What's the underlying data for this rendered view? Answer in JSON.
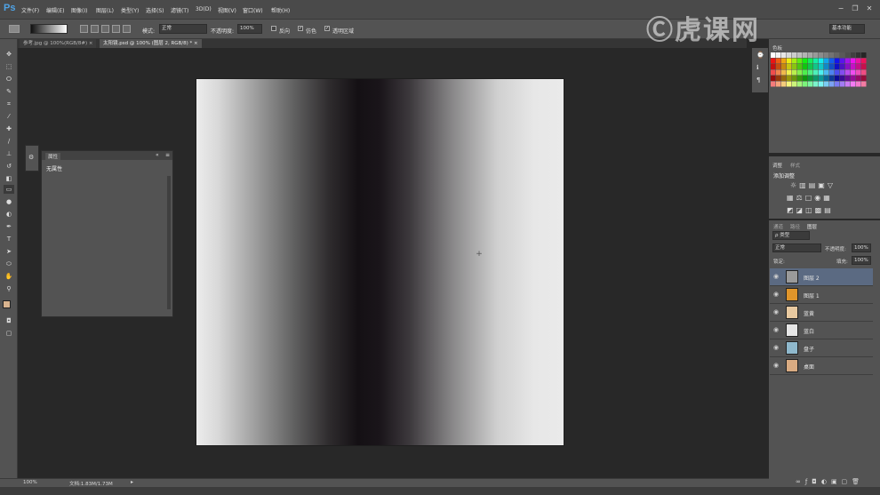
{
  "app": {
    "logo": "Ps",
    "watermark": "虎课网"
  },
  "menu": [
    "文件(F)",
    "编辑(E)",
    "图像(I)",
    "图层(L)",
    "类型(Y)",
    "选择(S)",
    "滤镜(T)",
    "3D(D)",
    "视图(V)",
    "窗口(W)",
    "帮助(H)"
  ],
  "options": {
    "mode_label": "模式:",
    "mode_value": "正常",
    "opacity_label": "不透明度:",
    "opacity_value": "100%",
    "reverse_label": "反向",
    "dither_label": "仿色",
    "transparency_label": "透明区域",
    "workspace": "基本功能"
  },
  "tabs": [
    "参考.jpg @ 100%(RGB/8#) ×",
    "太阳镜.psd @ 100% (图层 2, RGB/8) * ×"
  ],
  "properties": {
    "title": "属性",
    "no_properties": "无属性"
  },
  "swatches": {
    "title": "色板"
  },
  "adjustments": {
    "tabs": [
      "调整",
      "样式"
    ],
    "add_label": "添加调整"
  },
  "layers": {
    "tabs": [
      "通道",
      "路径",
      "图层"
    ],
    "filter_label": "ρ 类型",
    "blend_mode": "正常",
    "opacity_label": "不透明度:",
    "opacity_value": "100%",
    "lock_label": "锁定:",
    "fill_label": "填充:",
    "fill_value": "100%",
    "items": [
      {
        "name": "图层 2",
        "thumb": "#9a9a9a",
        "selected": true
      },
      {
        "name": "图层 1",
        "thumb": "#e0952a",
        "selected": false
      },
      {
        "name": "蓝黄",
        "thumb": "#e8c9a0",
        "selected": false
      },
      {
        "name": "蓝白",
        "thumb": "#e6e6e6",
        "selected": false
      },
      {
        "name": "盘子",
        "thumb": "#8fb8cc",
        "selected": false
      },
      {
        "name": "桌面",
        "thumb": "#d9ab82",
        "selected": false
      }
    ]
  },
  "status": {
    "zoom": "100%",
    "doc": "文档:1.83M/1.73M"
  },
  "colors": {
    "foreground": "#d9b48f",
    "background": "#ffffff"
  }
}
